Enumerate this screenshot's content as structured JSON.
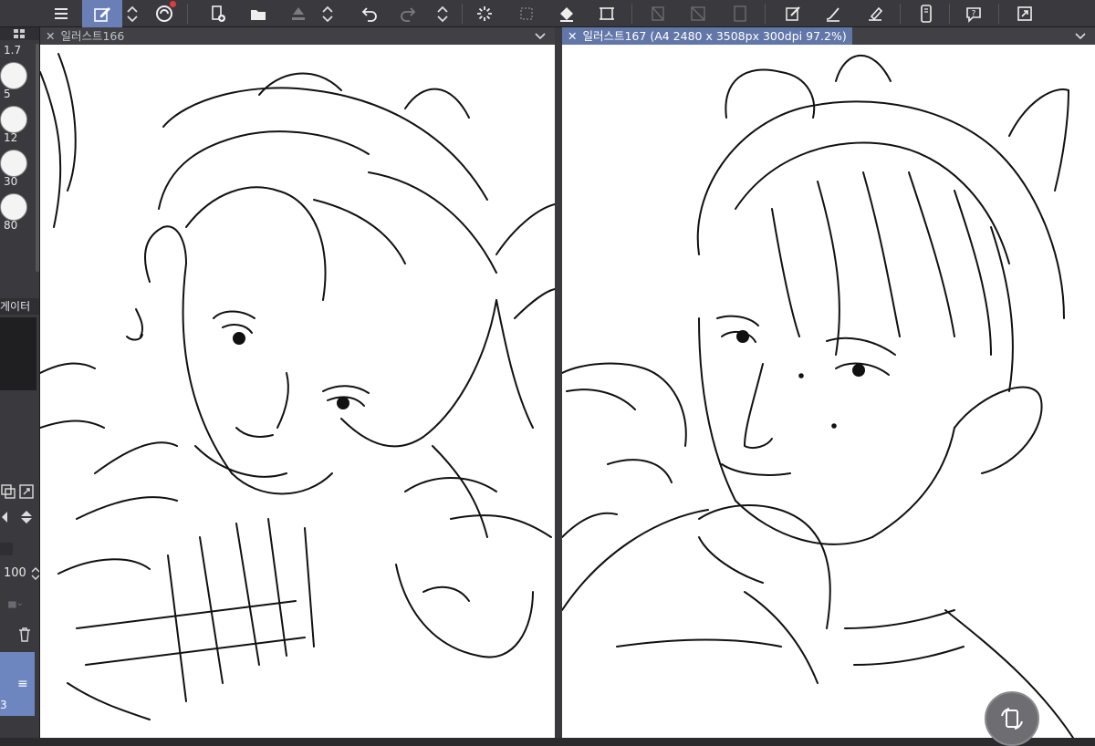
{
  "toolbar": {
    "icons": [
      "menu-icon",
      "edit-layer-icon",
      "chevron-updown-icon",
      "logo-icon",
      "new-layer-icon",
      "open-folder-icon",
      "save-icon",
      "chevron-updown-icon",
      "undo-icon",
      "redo-icon",
      "chevron-updown-icon",
      "loading-icon",
      "transform-icon",
      "fill-icon",
      "crop-icon",
      "ruler-icon",
      "text-icon",
      "panel-icon",
      "draw-icon",
      "pen-icon",
      "eraser-icon",
      "phone-icon",
      "help-icon",
      "expand-icon"
    ],
    "accent": "#6a7fb5"
  },
  "brush_sizes": [
    "1.7",
    "5",
    "12",
    "30",
    "80"
  ],
  "layer_panel": {
    "title": "게이터",
    "opacity": "100",
    "layer_number": "3"
  },
  "documents": [
    {
      "tab_label": "일러스트166",
      "active": false
    },
    {
      "tab_label": "일러스트167 (A4 2480 x 3508px 300dpi 97.2%)",
      "active": true
    }
  ],
  "colors": {
    "toolbar_bg": "#3a3a3e",
    "active_tab": "#6276a8",
    "selected_layer": "#6d86c0"
  }
}
